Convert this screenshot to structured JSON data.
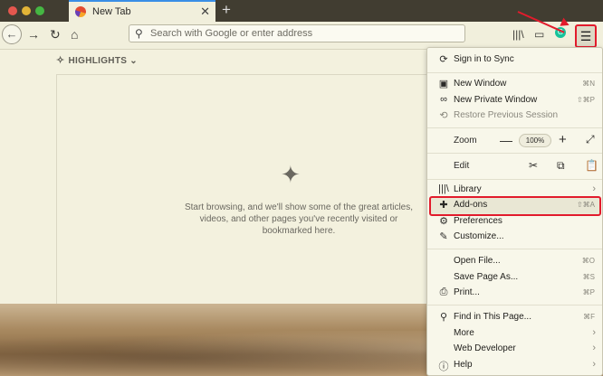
{
  "tab": {
    "title": "New Tab"
  },
  "toolbar": {
    "search_placeholder": "Search with Google or enter address",
    "grammarly_label": "G"
  },
  "highlights": {
    "label": "HIGHLIGHTS"
  },
  "empty_state": {
    "text": "Start browsing, and we'll show some of the great articles, videos, and other pages you've recently visited or bookmarked here."
  },
  "menu": {
    "sign_in": "Sign in to Sync",
    "new_window": {
      "label": "New Window",
      "shortcut": "⌘N"
    },
    "new_private": {
      "label": "New Private Window",
      "shortcut": "⇧⌘P"
    },
    "restore": {
      "label": "Restore Previous Session"
    },
    "zoom": {
      "label": "Zoom",
      "minus": "—",
      "level": "100%",
      "plus": "+"
    },
    "edit": {
      "label": "Edit"
    },
    "library": {
      "label": "Library"
    },
    "addons": {
      "label": "Add-ons",
      "shortcut": "⇧⌘A"
    },
    "preferences": {
      "label": "Preferences"
    },
    "customize": {
      "label": "Customize..."
    },
    "open_file": {
      "label": "Open File...",
      "shortcut": "⌘O"
    },
    "save_page": {
      "label": "Save Page As...",
      "shortcut": "⌘S"
    },
    "print": {
      "label": "Print...",
      "shortcut": "⌘P"
    },
    "find": {
      "label": "Find in This Page...",
      "shortcut": "⌘F"
    },
    "more": {
      "label": "More"
    },
    "web_dev": {
      "label": "Web Developer"
    },
    "help": {
      "label": "Help"
    }
  },
  "colors": {
    "annotation": "#e21b2c",
    "accent": "#3a8ee6"
  }
}
